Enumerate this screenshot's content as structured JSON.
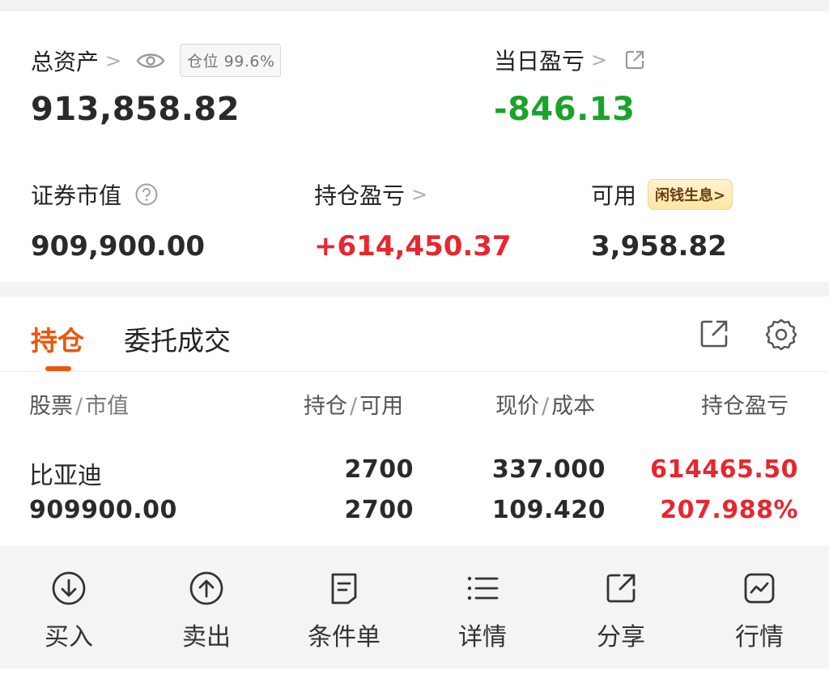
{
  "summary": {
    "total_assets": {
      "label": "总资产",
      "chevron": ">",
      "value": "913,858.82",
      "position_badge": "仓位 99.6%"
    },
    "daily_pnl": {
      "label": "当日盈亏",
      "chevron": ">",
      "value": "-846.13"
    },
    "market_value": {
      "label": "证券市值",
      "value": "909,900.00"
    },
    "holding_pnl": {
      "label": "持仓盈亏",
      "chevron": ">",
      "value": "+614,450.37"
    },
    "available": {
      "label": "可用",
      "value": "3,958.82",
      "promo_badge": "闲钱生息>"
    }
  },
  "tabs": {
    "items": [
      {
        "label": "持仓",
        "active": true
      },
      {
        "label": "委托成交",
        "active": false
      }
    ]
  },
  "table": {
    "headers": [
      {
        "main": "股票",
        "sub": "市值"
      },
      {
        "main": "持仓",
        "sub": "可用"
      },
      {
        "main": "现价",
        "sub": "成本"
      },
      {
        "main": "持仓盈亏",
        "sub": ""
      }
    ],
    "separator": "/",
    "rows": [
      {
        "name": "比亚迪",
        "market_value": "909900.00",
        "holding": "2700",
        "available": "2700",
        "price": "337.000",
        "cost": "109.420",
        "pnl": "614465.50",
        "pnl_pct": "207.988%"
      }
    ]
  },
  "actions": [
    {
      "label": "买入",
      "icon": "buy-circle-arrow-down-icon"
    },
    {
      "label": "卖出",
      "icon": "sell-circle-arrow-up-icon"
    },
    {
      "label": "条件单",
      "icon": "document-icon"
    },
    {
      "label": "详情",
      "icon": "list-icon"
    },
    {
      "label": "分享",
      "icon": "share-icon"
    },
    {
      "label": "行情",
      "icon": "chart-icon"
    }
  ],
  "colors": {
    "accent": "#e8580c",
    "up": "#e8262e",
    "down": "#1aa32a"
  }
}
